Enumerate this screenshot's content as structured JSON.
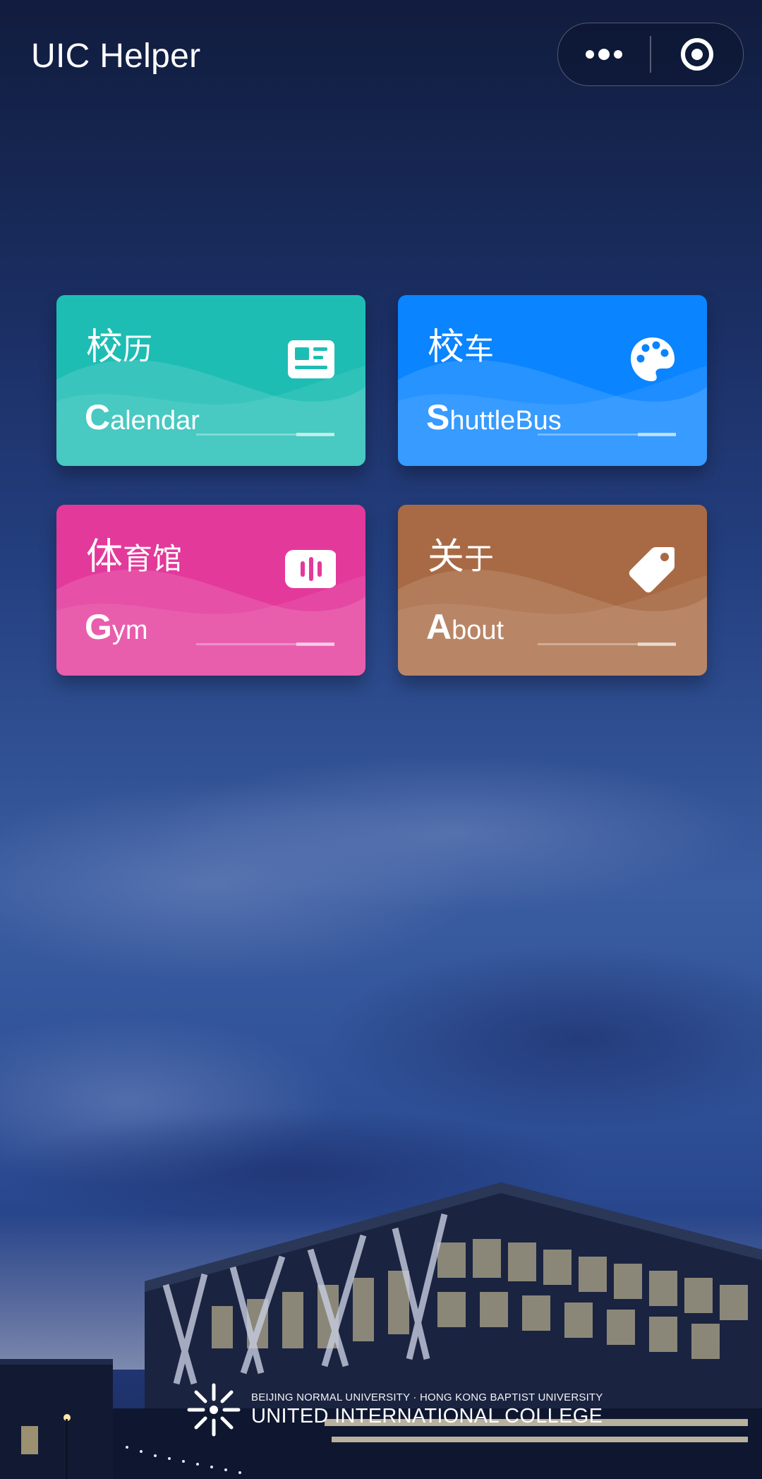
{
  "header": {
    "title": "UIC Helper"
  },
  "capsule": {
    "more_icon": "more-dots-icon",
    "close_icon": "target-circle-icon"
  },
  "cards": [
    {
      "zh_first": "校",
      "zh_rest": "历",
      "en_first": "C",
      "en_rest": "alendar",
      "icon": "newspaper-icon",
      "color": "#1ebdb4"
    },
    {
      "zh_first": "校",
      "zh_rest": "车",
      "en_first": "S",
      "en_rest": "huttleBus",
      "icon": "palette-icon",
      "color": "#0a84ff"
    },
    {
      "zh_first": "体",
      "zh_rest": "育馆",
      "en_first": "G",
      "en_rest": "ym",
      "icon": "voice-bars-icon",
      "color": "#e3399b"
    },
    {
      "zh_first": "关",
      "zh_rest": "于",
      "en_first": "A",
      "en_rest": "bout",
      "icon": "tag-icon",
      "color": "#a86a44"
    }
  ],
  "footer": {
    "line1": "BEIJING NORMAL UNIVERSITY · HONG KONG BAPTIST UNIVERSITY",
    "line2": "UNITED INTERNATIONAL COLLEGE",
    "logo_icon": "uic-logo-icon"
  }
}
